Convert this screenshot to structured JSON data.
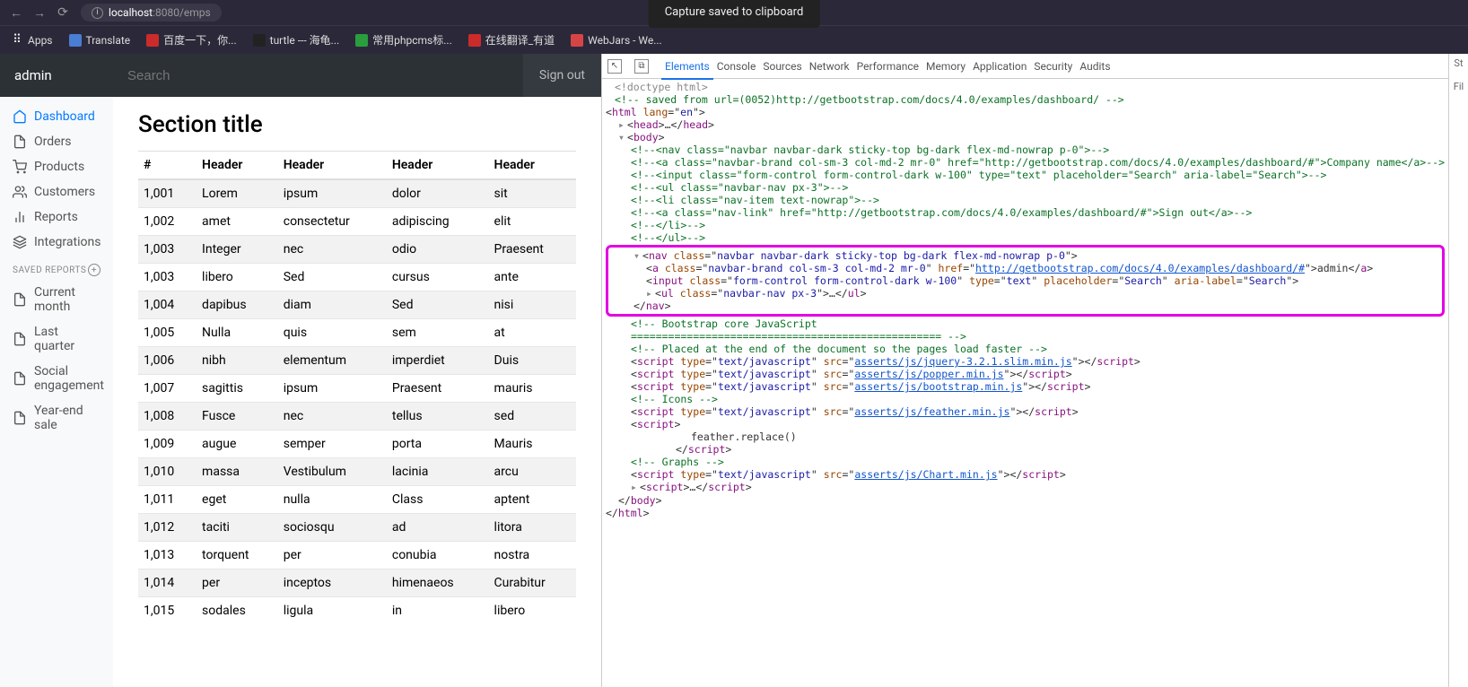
{
  "browser": {
    "url_host": "localhost",
    "url_port": ":8080",
    "url_path": "/emps",
    "toast": "Capture saved to clipboard",
    "bookmarks": [
      {
        "label": "Apps",
        "color": "#4285f4"
      },
      {
        "label": "Translate",
        "color": "#4a7dd4"
      },
      {
        "label": "百度一下，你...",
        "color": "#cc2b2b"
      },
      {
        "label": "turtle --- 海龟...",
        "color": "#222"
      },
      {
        "label": "常用phpcms标...",
        "color": "#2a9d3f"
      },
      {
        "label": "在线翻译_有道",
        "color": "#cc2b2b"
      },
      {
        "label": "WebJars - We...",
        "color": "#d64545"
      }
    ]
  },
  "navbar": {
    "brand": "admin",
    "search_placeholder": "Search",
    "signout": "Sign out"
  },
  "sidebar": {
    "items": [
      {
        "label": "Dashboard",
        "active": true
      },
      {
        "label": "Orders"
      },
      {
        "label": "Products"
      },
      {
        "label": "Customers"
      },
      {
        "label": "Reports"
      },
      {
        "label": "Integrations"
      }
    ],
    "saved_heading": "SAVED REPORTS",
    "saved": [
      "Current month",
      "Last quarter",
      "Social engagement",
      "Year-end sale"
    ]
  },
  "section_title": "Section title",
  "table": {
    "head": [
      "#",
      "Header",
      "Header",
      "Header",
      "Header"
    ],
    "rows": [
      [
        "1,001",
        "Lorem",
        "ipsum",
        "dolor",
        "sit"
      ],
      [
        "1,002",
        "amet",
        "consectetur",
        "adipiscing",
        "elit"
      ],
      [
        "1,003",
        "Integer",
        "nec",
        "odio",
        "Praesent"
      ],
      [
        "1,003",
        "libero",
        "Sed",
        "cursus",
        "ante"
      ],
      [
        "1,004",
        "dapibus",
        "diam",
        "Sed",
        "nisi"
      ],
      [
        "1,005",
        "Nulla",
        "quis",
        "sem",
        "at"
      ],
      [
        "1,006",
        "nibh",
        "elementum",
        "imperdiet",
        "Duis"
      ],
      [
        "1,007",
        "sagittis",
        "ipsum",
        "Praesent",
        "mauris"
      ],
      [
        "1,008",
        "Fusce",
        "nec",
        "tellus",
        "sed"
      ],
      [
        "1,009",
        "augue",
        "semper",
        "porta",
        "Mauris"
      ],
      [
        "1,010",
        "massa",
        "Vestibulum",
        "lacinia",
        "arcu"
      ],
      [
        "1,011",
        "eget",
        "nulla",
        "Class",
        "aptent"
      ],
      [
        "1,012",
        "taciti",
        "sociosqu",
        "ad",
        "litora"
      ],
      [
        "1,013",
        "torquent",
        "per",
        "conubia",
        "nostra"
      ],
      [
        "1,014",
        "per",
        "inceptos",
        "himenaeos",
        "Curabitur"
      ],
      [
        "1,015",
        "sodales",
        "ligula",
        "in",
        "libero"
      ]
    ]
  },
  "devtools": {
    "tabs": [
      "Elements",
      "Console",
      "Sources",
      "Network",
      "Performance",
      "Memory",
      "Application",
      "Security",
      "Audits"
    ],
    "side": [
      "St",
      "",
      "Fil"
    ],
    "doctype": "<!doctype html>",
    "savedfrom": "<!-- saved from url=(0052)http://getbootstrap.com/docs/4.0/examples/dashboard/ -->",
    "html_open": {
      "tag": "html",
      "lang": "en"
    },
    "head": "<head>…</head>",
    "body": "<body>",
    "cmt_nav": "<!--<nav class=\"navbar navbar-dark sticky-top bg-dark flex-md-nowrap p-0\">-->",
    "cmt_a": "<!--<a class=\"navbar-brand col-sm-3 col-md-2 mr-0\" href=\"http://getbootstrap.com/docs/4.0/examples/dashboard/#\">Company name</a>-->",
    "cmt_input": "<!--<input class=\"form-control form-control-dark w-100\" type=\"text\" placeholder=\"Search\" aria-label=\"Search\">-->",
    "cmt_ul": "<!--<ul class=\"navbar-nav px-3\">-->",
    "cmt_li": "<!--<li class=\"nav-item text-nowrap\">-->",
    "cmt_a2": "<!--<a class=\"nav-link\" href=\"http://getbootstrap.com/docs/4.0/examples/dashboard/#\">Sign out</a>-->",
    "cmt_li_close": "<!--</li>-->",
    "cmt_ul_close": "<!--</ul>-->",
    "nav": {
      "open": {
        "tag": "nav",
        "cls": "navbar navbar-dark sticky-top bg-dark flex-md-nowrap p-0"
      },
      "a": {
        "tag": "a",
        "cls": "navbar-brand col-sm-3 col-md-2 mr-0",
        "href": "http://getbootstrap.com/docs/4.0/examples/dashboard/#",
        "text": "admin"
      },
      "input": {
        "tag": "input",
        "cls": "form-control form-control-dark w-100",
        "type": "text",
        "ph": "Search",
        "al": "Search"
      },
      "ul": {
        "tag": "ul",
        "cls": "navbar-nav px-3",
        "rest": ">…</ul>"
      },
      "close": "</nav>"
    },
    "cmt_bs": "<!-- Bootstrap core JavaScript",
    "cmt_bs2": "    ================================================== -->",
    "cmt_placed": "<!-- Placed at the end of the document so the pages load faster -->",
    "scripts": [
      {
        "src": "asserts/js/jquery-3.2.1.slim.min.js"
      },
      {
        "src": "asserts/js/popper.min.js"
      },
      {
        "src": "asserts/js/bootstrap.min.js"
      }
    ],
    "cmt_icons": "<!-- Icons -->",
    "script_feather": {
      "src": "asserts/js/feather.min.js"
    },
    "inline1_open": "<script>",
    "inline1_body": "feather.replace()",
    "inline1_close_tag": "script",
    "cmt_graphs": "<!-- Graphs -->",
    "script_chart": {
      "src": "asserts/js/Chart.min.js"
    },
    "inline2": {
      "open": "<script>",
      "rest": "…",
      "close_tag": "script"
    },
    "body_close": "</body>",
    "html_close": "</html>"
  }
}
